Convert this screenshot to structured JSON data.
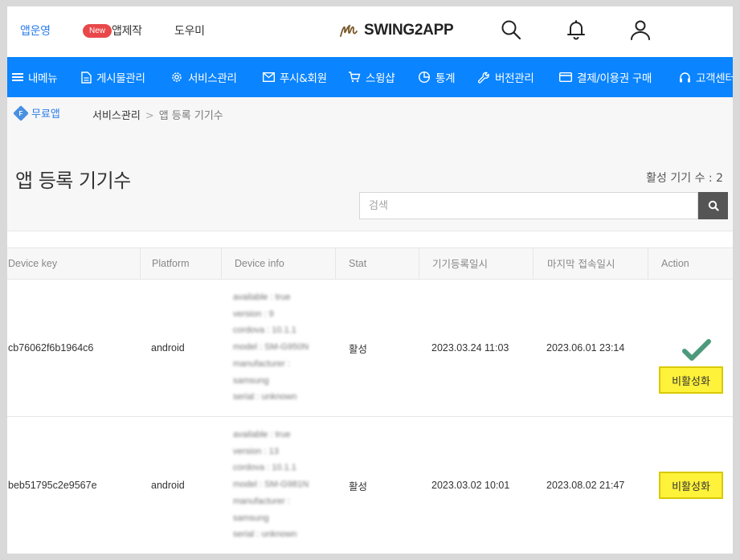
{
  "header": {
    "links": [
      "앱운영",
      "앱제작",
      "도우미"
    ],
    "new_badge": "New",
    "logo_text": "SWING2APP",
    "icons": [
      "search-icon",
      "bell-icon",
      "user-icon"
    ]
  },
  "nav": {
    "items": [
      {
        "label": "내메뉴",
        "icon": "menu-icon"
      },
      {
        "label": "게시물관리",
        "icon": "document-icon"
      },
      {
        "label": "서비스관리",
        "icon": "gear-icon"
      },
      {
        "label": "푸시&회원",
        "icon": "mail-icon"
      },
      {
        "label": "스윙샵",
        "icon": "cart-icon"
      },
      {
        "label": "통계",
        "icon": "pie-icon"
      },
      {
        "label": "버전관리",
        "icon": "wrench-icon"
      },
      {
        "label": "결제/이용권 구매",
        "icon": "card-icon"
      },
      {
        "label": "고객센터",
        "icon": "headset-icon"
      }
    ],
    "color": "#0a84ff"
  },
  "breadcrumb": {
    "badge": "F",
    "free_label": "무료앱",
    "section": "서비스관리",
    "separator": ">",
    "current": "앱 등록 기기수"
  },
  "page": {
    "title": "앱 등록 기기수",
    "active_count": "활성 기기 수 : 2",
    "search_placeholder": "검색"
  },
  "table": {
    "columns": [
      "Device key",
      "Platform",
      "Device info",
      "Stat",
      "기기등록일시",
      "마지막 접속일시",
      "Action"
    ],
    "rows": [
      {
        "device_key": "cb76062f6b1964c6",
        "platform": "android",
        "device_info": [
          "available : true",
          "version : 9",
          "cordova : 10.1.1",
          "model : SM-G950N",
          "manufacturer :",
          "samsung",
          "serial : unknown"
        ],
        "stat": "활성",
        "registered": "2023.03.24 11:03",
        "last_access": "2023.06.01 23:14",
        "action": "비활성화",
        "checked": true
      },
      {
        "device_key": "beb51795c2e9567e",
        "platform": "android",
        "device_info": [
          "available : true",
          "version : 13",
          "cordova : 10.1.1",
          "model : SM-G981N",
          "manufacturer :",
          "samsung",
          "serial : unknown"
        ],
        "stat": "활성",
        "registered": "2023.03.02 10:01",
        "last_access": "2023.08.02 21:47",
        "action": "비활성화",
        "checked": false
      }
    ]
  },
  "colors": {
    "accent": "#0a84ff",
    "link": "#2b7de9",
    "badge": "#e9484b",
    "action_button": "#fff23a",
    "check": "#4c9a7c"
  }
}
